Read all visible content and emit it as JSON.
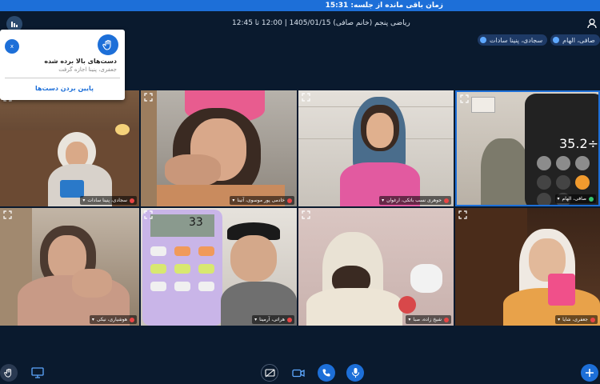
{
  "top_banner": {
    "text": "زمان باقی مانده از جلسه: 15:31"
  },
  "header": {
    "session_info": "ریاضی پنجم (خانم صافی) 1405/01/15 | 12:00 تا 12:45"
  },
  "presenter_chips": [
    {
      "label": "صافی، الهام"
    },
    {
      "label": "سجادی، پنینا سادات"
    }
  ],
  "raise_hand_popup": {
    "title": "دست‌های بالا برده شده",
    "subtitle": "جعفری، پنینا اجازه گرفت",
    "lower_hands_label": "پایین بردن دست‌ها",
    "close_label": "x"
  },
  "participants": [
    {
      "name": "سجادی، پنینا سادات"
    },
    {
      "name": "خادمی پور موسوی، آتینا"
    },
    {
      "name": "جوهری نسب باتکی، ارغوان"
    },
    {
      "name": "صافی، الهام"
    },
    {
      "name": "هوشیاری، نیکی"
    },
    {
      "name": "هراتی، آرمینا"
    },
    {
      "name": "شیخ زاده، صبا"
    },
    {
      "name": "جعفری، شایا"
    }
  ],
  "colors": {
    "accent": "#1d6fd8",
    "background": "#0a1a2e",
    "mic_off": "#e84545",
    "mic_on": "#34c36b"
  }
}
